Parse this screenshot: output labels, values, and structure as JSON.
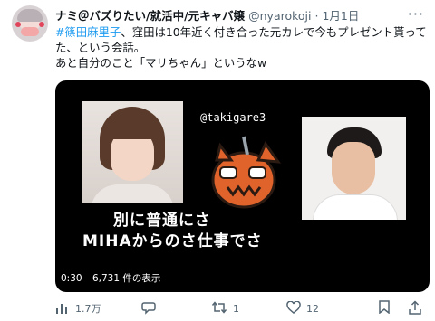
{
  "tweet": {
    "display_name": "ナミ＠バズりたい/就活中/元キャバ嬢",
    "handle": "@nyarokoji",
    "separator": "·",
    "date": "1月1日",
    "more_label": "···",
    "hashtag": "#篠田麻里子",
    "text_line1_rest": "、窪田は10年近く付き合った元カレで今もプレゼント貰って",
    "text_line2": "た、という会話。",
    "text_line3": "あと自分のこと「マリちゃん」というなw"
  },
  "video": {
    "watermark": "@takigare3",
    "caption_line1": "別に普通にさ",
    "caption_line2": "MIHAからのさ仕事でさ",
    "time": "0:30",
    "views": "6,731 件の表示"
  },
  "actions": {
    "analytics": "1.7万",
    "reply": "",
    "retweet": "1",
    "like": "12",
    "bookmark": "",
    "share": ""
  },
  "icons": {
    "analytics": "bar-chart-icon",
    "reply": "speech-bubble-icon",
    "retweet": "retweet-icon",
    "like": "heart-icon",
    "bookmark": "bookmark-icon",
    "share": "share-icon"
  },
  "colors": {
    "hashtag": "#1d9bf0",
    "secondary_text": "#536471",
    "primary_text": "#0f1419"
  }
}
